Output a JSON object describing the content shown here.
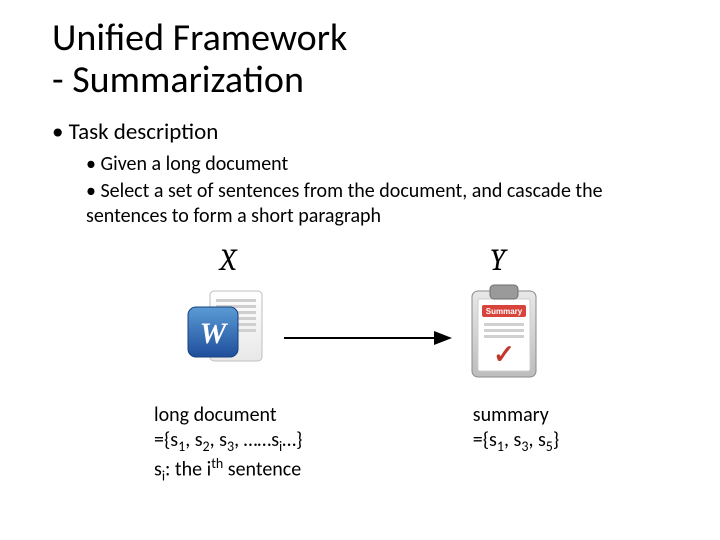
{
  "title_line1": "Unified Framework",
  "title_line2": "- Summarization",
  "bullets": {
    "l1": "Task description",
    "l2a": "Given a long document",
    "l2b": "Select a set of sentences from the document, and cascade the sentences to form a short paragraph"
  },
  "math": {
    "X": "X",
    "Y": "Y"
  },
  "icons": {
    "word": "word-document-icon",
    "clipboard": "summary-clipboard-icon",
    "arrow": "right-arrow-icon"
  },
  "captions": {
    "left_line1": "long document",
    "left_line2_prefix": "={s",
    "left_line2_mid": ", s",
    "left_line2_dots": ", ……s",
    "left_line2_suffix": "…}",
    "left_line3_a": "s",
    "left_line3_b": ": the i",
    "left_line3_c": " sentence",
    "right_line1": "summary",
    "right_line2": "={s",
    "right_line2_end": "}",
    "s1": "1",
    "s2": "2",
    "s3": "3",
    "s5": "5",
    "si": "i",
    "th": "th"
  },
  "clipboard_label": "Summary",
  "check": "✓"
}
